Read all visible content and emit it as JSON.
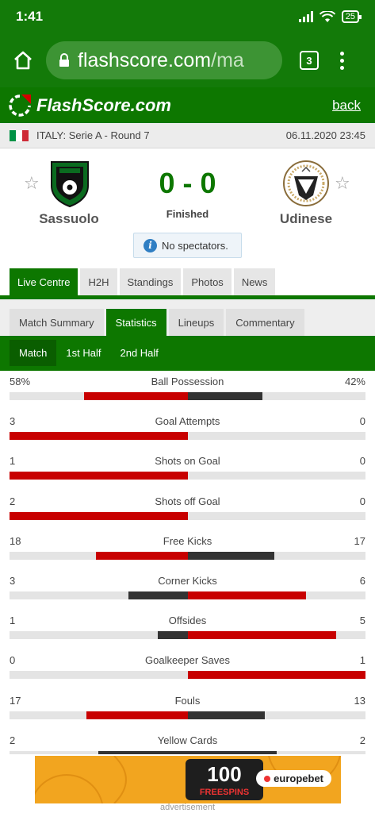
{
  "status_bar": {
    "time": "1:41",
    "battery": "25"
  },
  "browser": {
    "url_main": "flashscore.com",
    "url_rest": "/ma",
    "tab_count": "3"
  },
  "site": {
    "logo_text": "FlashScore.com",
    "back_label": "back"
  },
  "league": {
    "name": "ITALY: Serie A - Round 7",
    "datetime": "06.11.2020 23:45",
    "flag_colors": [
      "#009246",
      "#ffffff",
      "#ce2b37"
    ]
  },
  "match": {
    "home_team": "Sassuolo",
    "away_team": "Udinese",
    "score": "0 - 0",
    "status": "Finished",
    "notice": "No spectators."
  },
  "main_tabs": [
    {
      "label": "Live Centre",
      "active": true
    },
    {
      "label": "H2H",
      "active": false
    },
    {
      "label": "Standings",
      "active": false
    },
    {
      "label": "Photos",
      "active": false
    },
    {
      "label": "News",
      "active": false
    }
  ],
  "sub_tabs": [
    {
      "label": "Match Summary",
      "active": false
    },
    {
      "label": "Statistics",
      "active": true
    },
    {
      "label": "Lineups",
      "active": false
    },
    {
      "label": "Commentary",
      "active": false
    }
  ],
  "period_tabs": [
    {
      "label": "Match",
      "active": true
    },
    {
      "label": "1st Half",
      "active": false
    },
    {
      "label": "2nd Half",
      "active": false
    }
  ],
  "stats": [
    {
      "label": "Ball Possession",
      "home": "58%",
      "away": "42%",
      "home_value": 58,
      "away_value": 42
    },
    {
      "label": "Goal Attempts",
      "home": "3",
      "away": "0",
      "home_value": 3,
      "away_value": 0
    },
    {
      "label": "Shots on Goal",
      "home": "1",
      "away": "0",
      "home_value": 1,
      "away_value": 0
    },
    {
      "label": "Shots off Goal",
      "home": "2",
      "away": "0",
      "home_value": 2,
      "away_value": 0
    },
    {
      "label": "Free Kicks",
      "home": "18",
      "away": "17",
      "home_value": 18,
      "away_value": 17
    },
    {
      "label": "Corner Kicks",
      "home": "3",
      "away": "6",
      "home_value": 3,
      "away_value": 6
    },
    {
      "label": "Offsides",
      "home": "1",
      "away": "5",
      "home_value": 1,
      "away_value": 5
    },
    {
      "label": "Goalkeeper Saves",
      "home": "0",
      "away": "1",
      "home_value": 0,
      "away_value": 1
    },
    {
      "label": "Fouls",
      "home": "17",
      "away": "13",
      "home_value": 17,
      "away_value": 13
    },
    {
      "label": "Yellow Cards",
      "home": "2",
      "away": "2",
      "home_value": 2,
      "away_value": 2
    }
  ],
  "colors": {
    "brand_green": "#0d7700",
    "leader_bar": "#c80000",
    "trailer_bar": "#333333",
    "bar_track": "#e4e4e4"
  },
  "ad": {
    "badge_number": "100",
    "badge_text": "FREESPINS",
    "brand": "europebet",
    "label": "advertisement"
  }
}
